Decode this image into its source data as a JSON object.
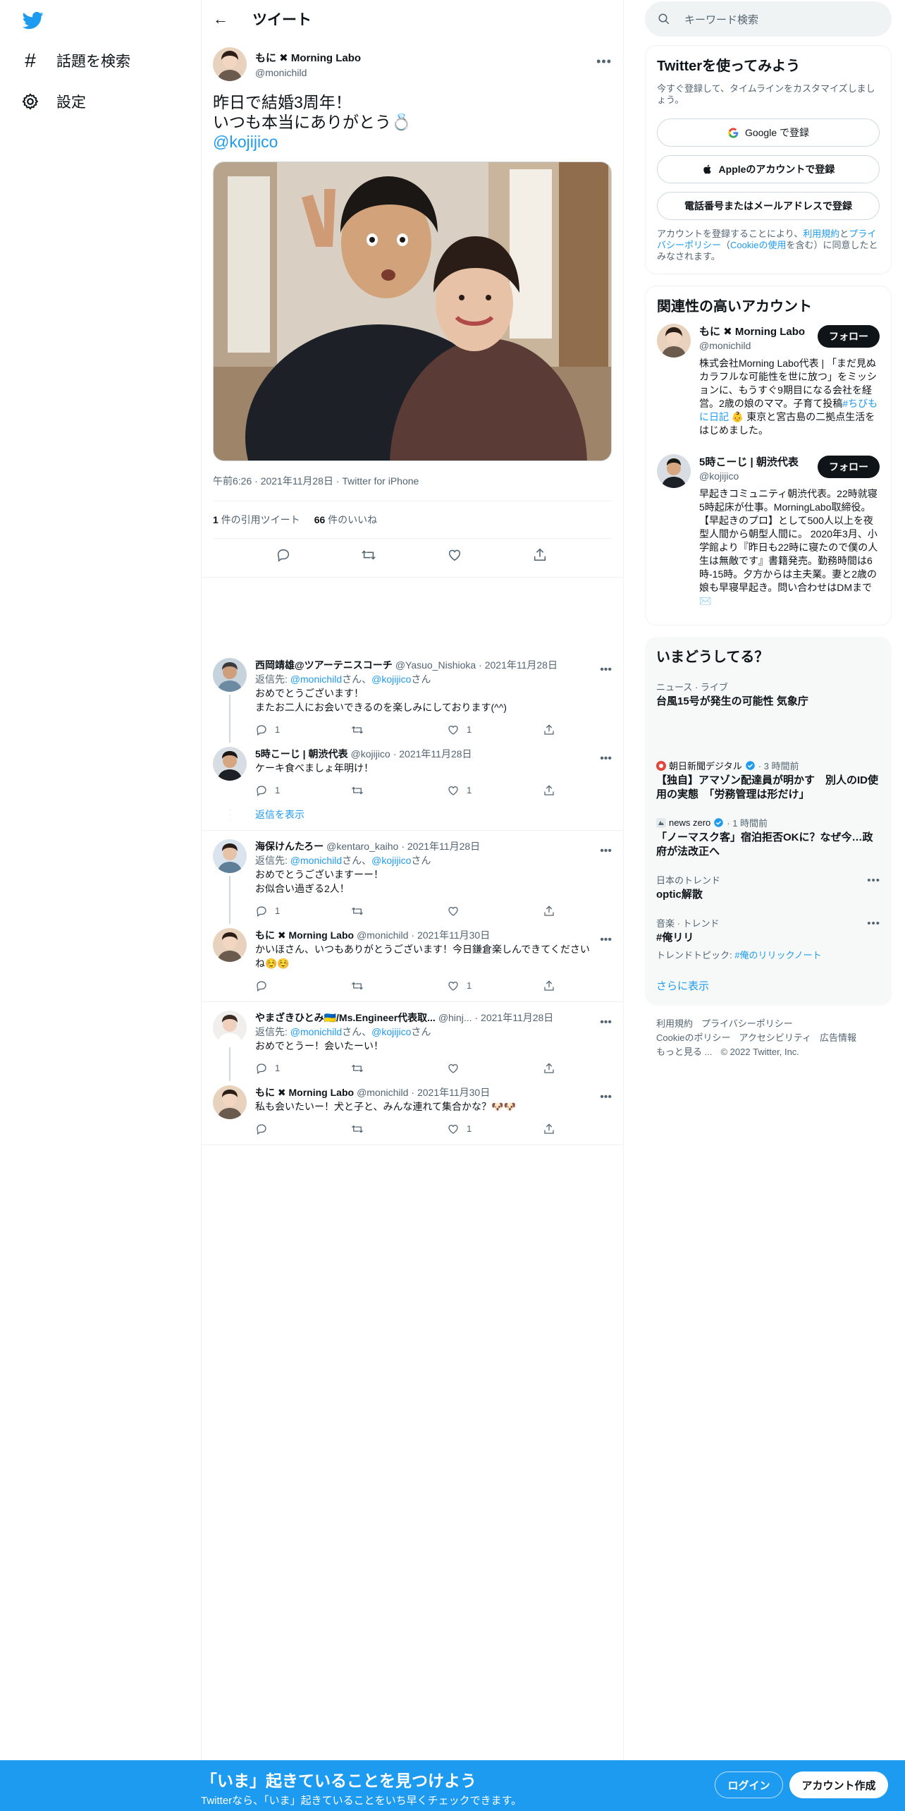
{
  "nav": {
    "items": [
      {
        "label": "話題を検索",
        "icon": "hashtag-icon"
      },
      {
        "label": "設定",
        "icon": "gear-icon"
      }
    ]
  },
  "header": {
    "title": "ツイート"
  },
  "main_tweet": {
    "name": "もに ✖︎ Morning Labo",
    "handle": "@monichild",
    "text_line1": "昨日で結婚3周年！",
    "text_line2": "いつも本当にありがとう💍",
    "mention": "@kojijico",
    "meta": "午前6:26 · 2021年11月28日 · Twitter for iPhone",
    "quote_count": "1",
    "quote_label": "件の引用ツイート",
    "like_count": "66",
    "like_label": "件のいいね"
  },
  "replies": [
    {
      "name": "西岡靖雄@ツアーテニスコーチ",
      "handle": "@Yasuo_Nishioka",
      "date": "· 2021年11月28日",
      "reply_prefix": "返信先: ",
      "reply_to1": "@monichild",
      "san1": "さん、",
      "reply_to2": "@kojijico",
      "san2": "さん",
      "text": [
        "おめでとうございます！",
        "またお二人にお会いできるのを楽しみにしております(^^)"
      ],
      "reply_count": "1",
      "retweet_count": "",
      "like_count": "1"
    },
    {
      "name": "5時こーじ | 朝渋代表",
      "handle": "@kojijico",
      "date": "· 2021年11月28日",
      "text": [
        "ケーキ食べましょ年明け！"
      ],
      "reply_count": "1",
      "retweet_count": "",
      "like_count": "1"
    },
    {
      "name": "海保けんたろー",
      "handle": "@kentaro_kaiho",
      "date": "· 2021年11月28日",
      "reply_prefix": "返信先: ",
      "reply_to1": "@monichild",
      "san1": "さん、",
      "reply_to2": "@kojijico",
      "san2": "さん",
      "text": [
        "おめでとうございますーー！",
        "お似合い過ぎる2人！"
      ],
      "reply_count": "1",
      "retweet_count": "",
      "like_count": ""
    },
    {
      "name": "もに ✖︎ Morning Labo",
      "handle": "@monichild",
      "date": "· 2021年11月30日",
      "text": [
        "かいほさん、いつもありがとうございます！今日鎌倉楽しんできてください",
        "ね☺️☺️"
      ],
      "reply_count": "",
      "retweet_count": "",
      "like_count": "1"
    },
    {
      "name": "やまざきひとみ🇺🇦/Ms.Engineer代表取...",
      "handle": "@hinj...",
      "date": "· 2021年11月28日",
      "reply_prefix": "返信先: ",
      "reply_to1": "@monichild",
      "san1": "さん、",
      "reply_to2": "@kojijico",
      "san2": "さん",
      "text": [
        "おめでとうー！会いたーい！"
      ],
      "reply_count": "1",
      "retweet_count": "",
      "like_count": ""
    },
    {
      "name": "もに ✖︎ Morning Labo",
      "handle": "@monichild",
      "date": "· 2021年11月30日",
      "text": [
        "私も会いたいー！犬と子と、みんな連れて集合かな？🐶🐶"
      ],
      "reply_count": "",
      "retweet_count": "",
      "like_count": "1"
    }
  ],
  "show_replies": "返信を表示",
  "search": {
    "placeholder": "キーワード検索"
  },
  "signup": {
    "title": "Twitterを使ってみよう",
    "desc": "今すぐ登録して、タイムラインをカスタマイズしましょう。",
    "google": "Google で登録",
    "apple": "Appleのアカウントで登録",
    "phone": "電話番号またはメールアドレスで登録",
    "legal_1": "アカウントを登録することにより、",
    "legal_terms": "利用規約",
    "legal_and": "と",
    "legal_privacy": "プライバシーポリシー",
    "legal_paren_open": "（",
    "legal_cookie": "Cookieの使用",
    "legal_2": "を含む）に同意したとみなされます。"
  },
  "related": {
    "title": "関連性の高いアカウント",
    "follow_label": "フォロー",
    "accounts": [
      {
        "name": "もに ✖︎ Morning Labo",
        "handle": "@monichild",
        "bio_1": "株式会社Morning Labo代表 | 「まだ見ぬカラフルな可能性を世に放つ」をミッションに、もうすぐ9期目になる会社を経営。2歳の娘のママ。子育て投稿",
        "bio_tag": "#ちびもに日記",
        "bio_2": "👶 東京と宮古島の二拠点生活をはじめました。"
      },
      {
        "name": "5時こーじ | 朝渋代表",
        "handle": "@kojijico",
        "bio_1": "早起きコミュニティ朝渋代表。22時就寝5時起床が仕事。MorningLabo取締役。【早起きのプロ】として500人以上を夜型人間から朝型人間に。 2020年3月、小学館より『昨日も22時に寝たので僕の人生は無敵です』書籍発売。勤務時間は6時-15時。夕方からは主夫業。妻と2歳の娘も早寝早起き。問い合わせはDMまで✉️",
        "bio_tag": "",
        "bio_2": ""
      }
    ]
  },
  "trends": {
    "title": "いまどうしてる？",
    "items": [
      {
        "context": "ニュース · ライブ",
        "title": "台風15号が発生の可能性 気象庁"
      },
      {
        "source": "朝日新聞デジタル",
        "time": "· 3 時間前",
        "title": "【独自】アマゾン配達員が明かす　別人のID使用の実態　「労務管理は形だけ」"
      },
      {
        "source": "news zero",
        "time": "· 1 時間前",
        "title": "「ノーマスク客」宿泊拒否OKに？なぜ今…政府が法改正へ"
      },
      {
        "context": "日本のトレンド",
        "title": "optic解散"
      },
      {
        "context": "音楽 · トレンド",
        "title": "#俺リリ",
        "sub_prefix": "トレンドトピック: ",
        "sub_link": "#俺のリリックノート"
      }
    ],
    "show_more": "さらに表示"
  },
  "footer": {
    "links_row1": [
      "利用規約",
      "プライバシーポリシー"
    ],
    "links_row2": [
      "Cookieのポリシー",
      "アクセシビリティ",
      "広告情報"
    ],
    "more": "もっと見る ...",
    "copyright": "© 2022 Twitter, Inc."
  },
  "bottom_bar": {
    "title": "「いま」起きていることを見つけよう",
    "subtitle": "Twitterなら、「いま」起きていることをいち早くチェックできます。",
    "login": "ログイン",
    "signup": "アカウント作成"
  },
  "colors": {
    "accent": "#1d9bf0",
    "text": "#0f1419",
    "muted": "#536471"
  }
}
